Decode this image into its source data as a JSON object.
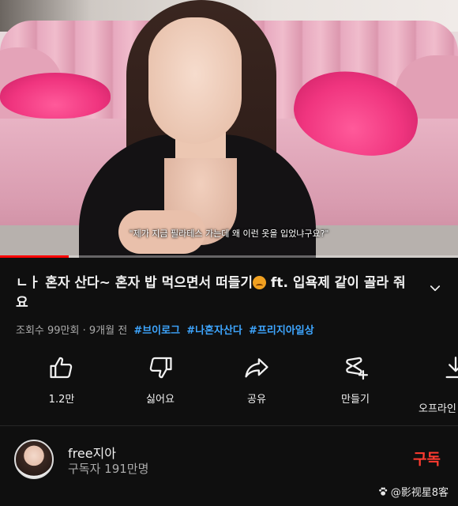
{
  "video": {
    "subtitle": "\"제가 지금 필라테스 가는데 왜 이런 옷을 입었냐구요?\"",
    "progress": 0.15,
    "progress_color": "#ff0000"
  },
  "title": {
    "text_before": "ㄴㅏ 혼자 산다~ 혼자 밥 먹으면서 떠들기",
    "emoji": "confounded-face",
    "text_after": " ft. 입욕제 같이 골라 줘요"
  },
  "meta": {
    "views": "조회수 99만회",
    "separator": " · ",
    "age": "9개월 전",
    "tags": [
      "#브이로그",
      "#나혼자산다",
      "#프리지아일상"
    ],
    "tag_color": "#3ea6ff"
  },
  "actions": [
    {
      "label": "1.2만",
      "icon": "thumbs-up-icon"
    },
    {
      "label": "싫어요",
      "icon": "thumbs-down-icon"
    },
    {
      "label": "공유",
      "icon": "share-icon"
    },
    {
      "label": "만들기",
      "icon": "create-icon"
    },
    {
      "label": "오프라인",
      "icon": "download-icon"
    }
  ],
  "channel": {
    "name": "free지아",
    "subscribers": "구독자 191만명",
    "subscribe_label": "구독",
    "subscribe_color": "#ff3b30"
  },
  "watermark": {
    "text": "@影视星8客"
  }
}
